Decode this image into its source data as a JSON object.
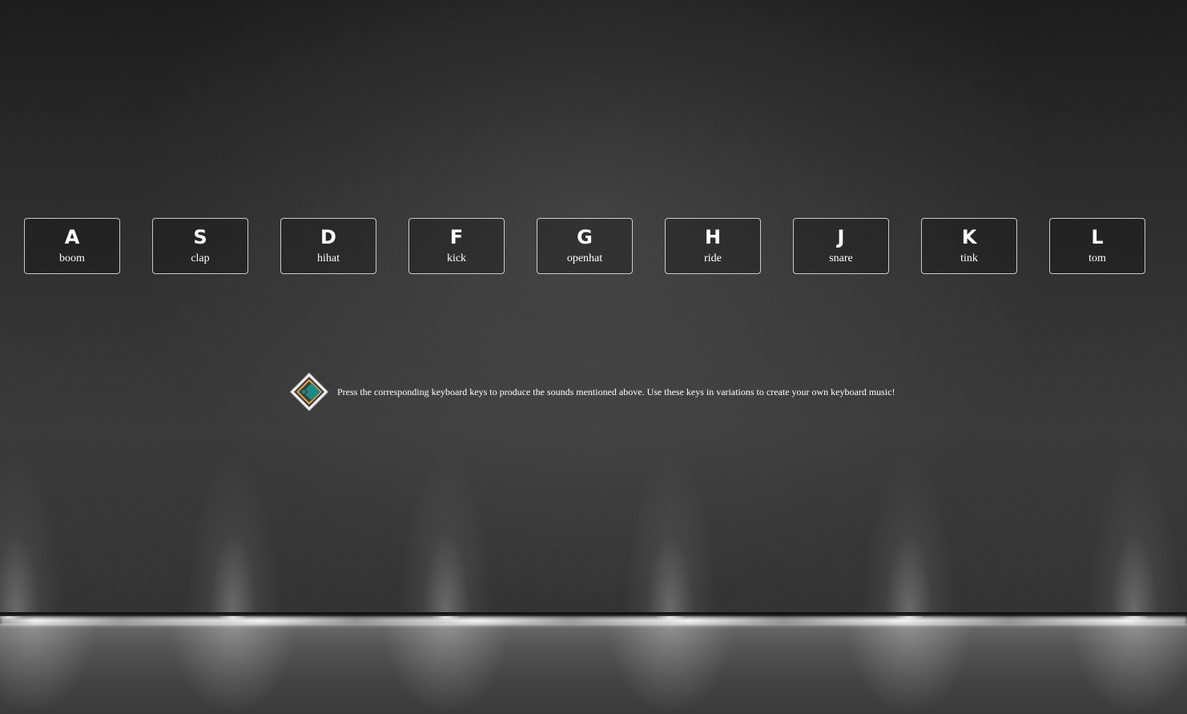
{
  "keys": [
    {
      "letter": "A",
      "sound": "boom"
    },
    {
      "letter": "S",
      "sound": "clap"
    },
    {
      "letter": "D",
      "sound": "hihat"
    },
    {
      "letter": "F",
      "sound": "kick"
    },
    {
      "letter": "G",
      "sound": "openhat"
    },
    {
      "letter": "H",
      "sound": "ride"
    },
    {
      "letter": "J",
      "sound": "snare"
    },
    {
      "letter": "K",
      "sound": "tink"
    },
    {
      "letter": "L",
      "sound": "tom"
    }
  ],
  "info": {
    "text": "Press the corresponding keyboard keys to produce the sounds mentioned above. Use these keys in variations to create your own keyboard music!",
    "logo_icon": "diamond-logo-icon"
  },
  "colors": {
    "key_border": "#ffffff",
    "text": "#ffffff",
    "logo_teal": "#1a8a84",
    "logo_orange": "#e0a040"
  }
}
